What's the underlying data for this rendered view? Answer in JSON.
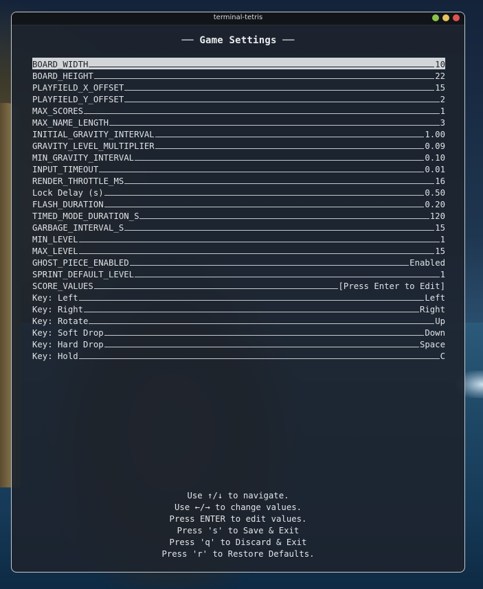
{
  "window": {
    "title": "terminal-tetris"
  },
  "heading": "── Game Settings ──",
  "settings": [
    {
      "label": "BOARD_WIDTH",
      "value": "10",
      "selected": true
    },
    {
      "label": "BOARD_HEIGHT",
      "value": "22"
    },
    {
      "label": "PLAYFIELD_X_OFFSET",
      "value": "15"
    },
    {
      "label": "PLAYFIELD_Y_OFFSET",
      "value": "2"
    },
    {
      "label": "MAX_SCORES",
      "value": "1"
    },
    {
      "label": "MAX_NAME_LENGTH",
      "value": "3"
    },
    {
      "label": "INITIAL_GRAVITY_INTERVAL",
      "value": "1.00"
    },
    {
      "label": "GRAVITY_LEVEL_MULTIPLIER",
      "value": "0.09"
    },
    {
      "label": "MIN_GRAVITY_INTERVAL",
      "value": "0.10"
    },
    {
      "label": "INPUT_TIMEOUT",
      "value": "0.01"
    },
    {
      "label": "RENDER_THROTTLE_MS",
      "value": "16"
    },
    {
      "label": "Lock Delay (s)",
      "value": "0.50"
    },
    {
      "label": "FLASH_DURATION",
      "value": "0.20"
    },
    {
      "label": "TIMED_MODE_DURATION_S",
      "value": "120"
    },
    {
      "label": "GARBAGE_INTERVAL_S",
      "value": "15"
    },
    {
      "label": "MIN_LEVEL",
      "value": "1"
    },
    {
      "label": "MAX_LEVEL",
      "value": "15"
    },
    {
      "label": "GHOST_PIECE_ENABLED",
      "value": "Enabled"
    },
    {
      "label": "SPRINT_DEFAULT_LEVEL",
      "value": "1"
    },
    {
      "label": "SCORE_VALUES",
      "value": "[Press Enter to Edit]"
    },
    {
      "label": "Key: Left",
      "value": "Left"
    },
    {
      "label": "Key: Right",
      "value": "Right"
    },
    {
      "label": "Key: Rotate",
      "value": "Up"
    },
    {
      "label": "Key: Soft Drop",
      "value": "Down"
    },
    {
      "label": "Key: Hard Drop",
      "value": "Space"
    },
    {
      "label": "Key: Hold",
      "value": "C"
    }
  ],
  "help": [
    "Use ↑/↓ to navigate.",
    "Use ←/→ to change values.",
    "Press ENTER to edit values.",
    "Press 's' to Save & Exit",
    "Press 'q' to Discard & Exit",
    "Press 'r' to Restore Defaults."
  ],
  "colors": {
    "window_bg": "#1d242d",
    "text": "#dfe2e5",
    "selected_bg": "#d3d6d9",
    "selected_text": "#1c2128",
    "btn_green": "#8bc34a",
    "btn_yellow": "#e6c35c",
    "btn_red": "#e05252"
  }
}
